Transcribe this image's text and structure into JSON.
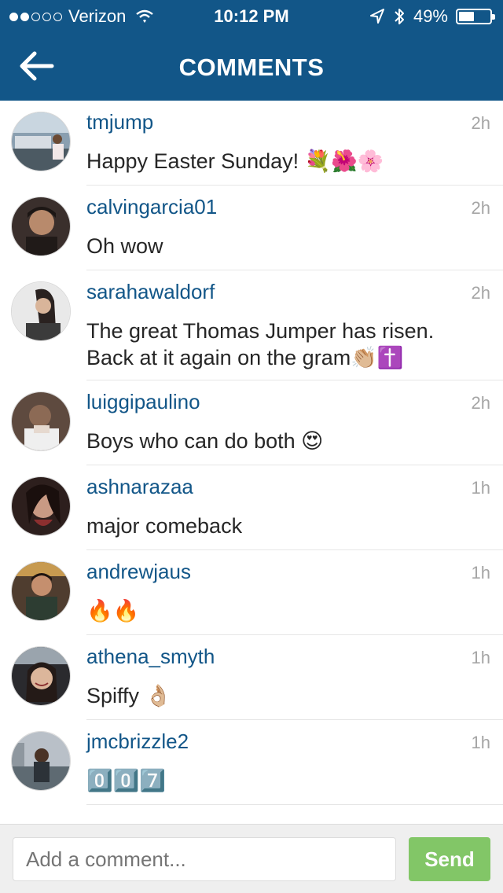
{
  "status_bar": {
    "carrier": "Verizon",
    "time": "10:12 PM",
    "battery": "49%",
    "battery_level": 0.49,
    "signal_filled": 2,
    "signal_total": 5
  },
  "navbar": {
    "title": "COMMENTS",
    "back_icon": "arrow-left-icon"
  },
  "comments": [
    {
      "username": "tmjump",
      "time": "2h",
      "text": "Happy Easter Sunday! 💐🌺🌸"
    },
    {
      "username": "calvingarcia01",
      "time": "2h",
      "text": "Oh wow"
    },
    {
      "username": "sarahawaldorf",
      "time": "2h",
      "text": "The great Thomas Jumper has risen. Back at it again on the gram👏🏼✝️"
    },
    {
      "username": "luiggipaulino",
      "time": "2h",
      "text": "Boys who can do both 😍"
    },
    {
      "username": "ashnarazaa",
      "time": "1h",
      "text": "major comeback"
    },
    {
      "username": "andrewjaus",
      "time": "1h",
      "text": "🔥🔥"
    },
    {
      "username": "athena_smyth",
      "time": "1h",
      "text": "Spiffy 👌🏼"
    },
    {
      "username": "jmcbrizzle2",
      "time": "1h",
      "text": "0️⃣0️⃣7️⃣"
    }
  ],
  "composer": {
    "placeholder": "Add a comment...",
    "send_label": "Send"
  },
  "colors": {
    "header": "#125688",
    "username": "#125688",
    "send": "#70c050"
  }
}
